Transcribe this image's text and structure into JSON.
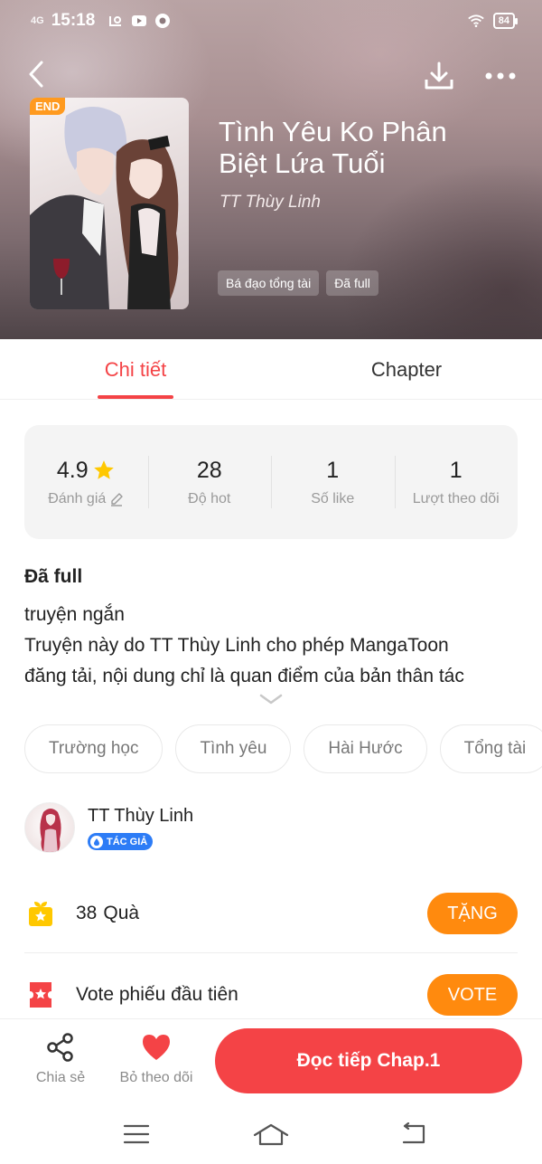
{
  "status_bar": {
    "signal": "4G",
    "time": "15:18",
    "battery": "84",
    "icons": [
      "signal-icon",
      "sync-icon",
      "youtube-icon",
      "chrome-icon",
      "wifi-icon",
      "battery-icon"
    ]
  },
  "hero": {
    "end_badge": "END",
    "title": "Tình Yêu Ko Phân Biệt Lứa Tuổi",
    "author": "TT Thùy Linh",
    "tags": [
      "Bá đạo tổng tài",
      "Đã full"
    ]
  },
  "tabs": [
    {
      "label": "Chi tiết",
      "active": true
    },
    {
      "label": "Chapter",
      "active": false
    }
  ],
  "stats": [
    {
      "value": "4.9",
      "label": "Đánh giá",
      "icon": "star-icon",
      "label_icon": "edit-icon"
    },
    {
      "value": "28",
      "label": "Độ hot"
    },
    {
      "value": "1",
      "label": "Số like"
    },
    {
      "value": "1",
      "label": "Lượt theo dõi"
    }
  ],
  "description": {
    "status": "Đã full",
    "lines": [
      "truyện ngắn",
      "Truyện này do TT Thùy Linh cho phép MangaToon",
      "đăng tải, nội dung chỉ là quan điểm của bản thân tác"
    ]
  },
  "genres": [
    "Trường học",
    "Tình yêu",
    "Hài Hước",
    "Tổng tài"
  ],
  "author": {
    "name": "TT Thùy Linh",
    "badge": "TÁC GIẢ"
  },
  "gift": {
    "count": "38",
    "label": "Quà",
    "button": "TẶNG"
  },
  "vote": {
    "label": "Vote phiếu đầu tiên",
    "button": "VOTE"
  },
  "bottom_bar": {
    "share": "Chia sẻ",
    "unfollow": "Bỏ theo dõi",
    "read": "Đọc tiếp Chap.1"
  },
  "colors": {
    "accent": "#f44346",
    "orange": "#ff8a0e",
    "badge_blue": "#2d7cf6",
    "end_badge": "#ff9a1f",
    "star": "#ffc800"
  }
}
